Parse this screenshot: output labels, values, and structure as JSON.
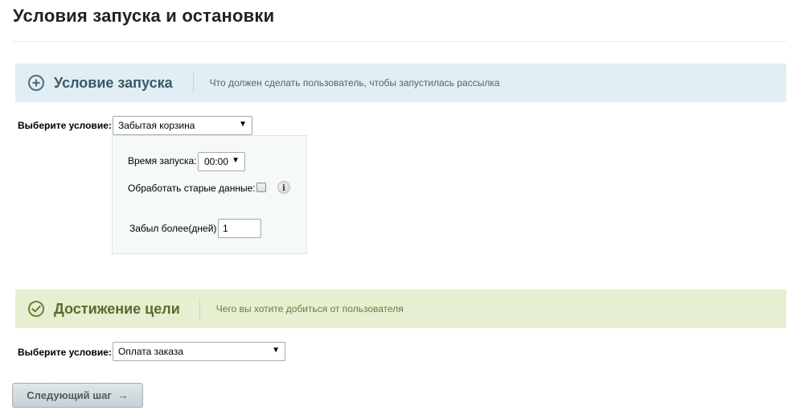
{
  "page": {
    "title": "Условия запуска и остановки"
  },
  "start_section": {
    "title": "Условие запуска",
    "description": "Что должен сделать пользователь, чтобы запустилась рассылка",
    "icon": "plus-circle-icon",
    "select_label": "Выберите условие:",
    "selected_condition": "Забытая корзина",
    "settings": {
      "run_time_label": "Время запуска:",
      "run_time_value": "00:00",
      "process_old_label": "Обработать старые данные:",
      "process_old_checked": false,
      "info_icon_glyph": "i",
      "forgot_days_label": "Забыл более(дней)",
      "forgot_days_value": "1"
    }
  },
  "goal_section": {
    "title": "Достижение цели",
    "description": "Чего вы хотите добиться от пользователя",
    "icon": "check-circle-icon",
    "select_label": "Выберите условие:",
    "selected_condition": "Оплата заказа"
  },
  "footer": {
    "next_label": "Следующий шаг",
    "next_arrow": "→"
  },
  "colors": {
    "start_band": "#e1eef4",
    "goal_band": "#e6efd1",
    "start_title": "#3c5966",
    "goal_title": "#5a6b2e"
  }
}
